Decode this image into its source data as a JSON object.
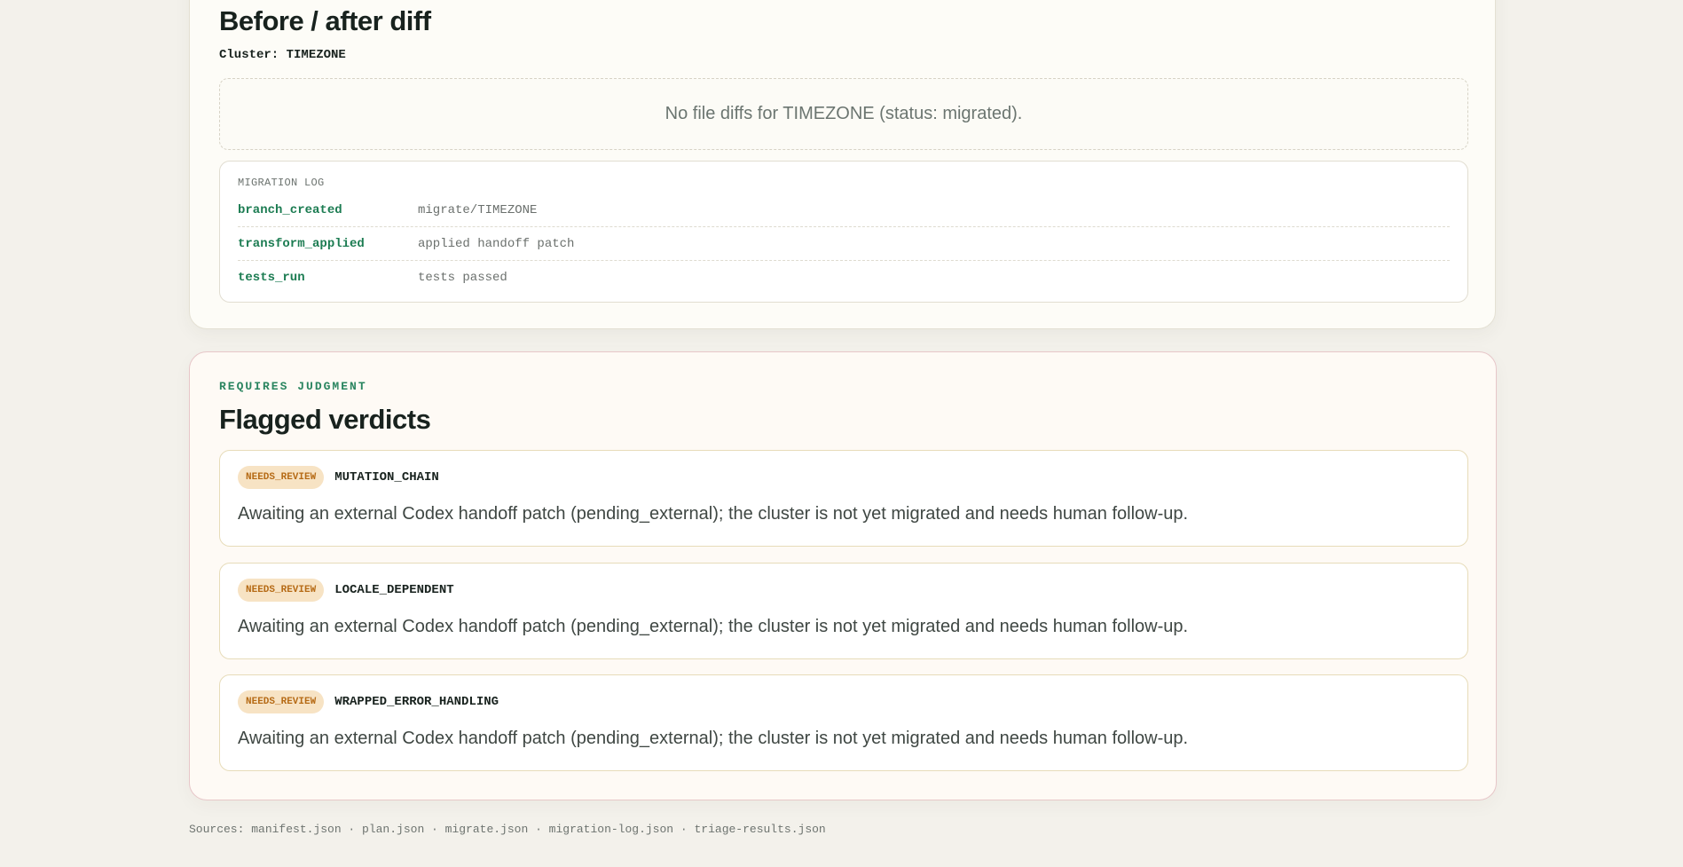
{
  "diff_panel": {
    "title": "Before / after diff",
    "cluster_line": "Cluster: TIMEZONE",
    "empty_message": "No file diffs for TIMEZONE (status: migrated).",
    "log": {
      "label": "MIGRATION LOG",
      "rows": [
        {
          "key": "branch_created",
          "value": "migrate/TIMEZONE"
        },
        {
          "key": "transform_applied",
          "value": "applied handoff patch"
        },
        {
          "key": "tests_run",
          "value": "tests passed"
        }
      ]
    }
  },
  "flagged_panel": {
    "eyebrow": "REQUIRES JUDGMENT",
    "title": "Flagged verdicts",
    "verdicts": [
      {
        "status": "NEEDS_REVIEW",
        "cluster": "MUTATION_CHAIN",
        "description": "Awaiting an external Codex handoff patch (pending_external); the cluster is not yet migrated and needs human follow-up."
      },
      {
        "status": "NEEDS_REVIEW",
        "cluster": "LOCALE_DEPENDENT",
        "description": "Awaiting an external Codex handoff patch (pending_external); the cluster is not yet migrated and needs human follow-up."
      },
      {
        "status": "NEEDS_REVIEW",
        "cluster": "WRAPPED_ERROR_HANDLING",
        "description": "Awaiting an external Codex handoff patch (pending_external); the cluster is not yet migrated and needs human follow-up."
      }
    ]
  },
  "footer": {
    "sources": "Sources: manifest.json · plan.json · migrate.json · migration-log.json · triage-results.json"
  },
  "colors": {
    "page_background": "#f3f1eb",
    "accent_green": "#1c7c52",
    "badge_background": "#f7e3c4",
    "badge_text": "#b66b16",
    "flag_panel_border": "#e7c7c9"
  }
}
